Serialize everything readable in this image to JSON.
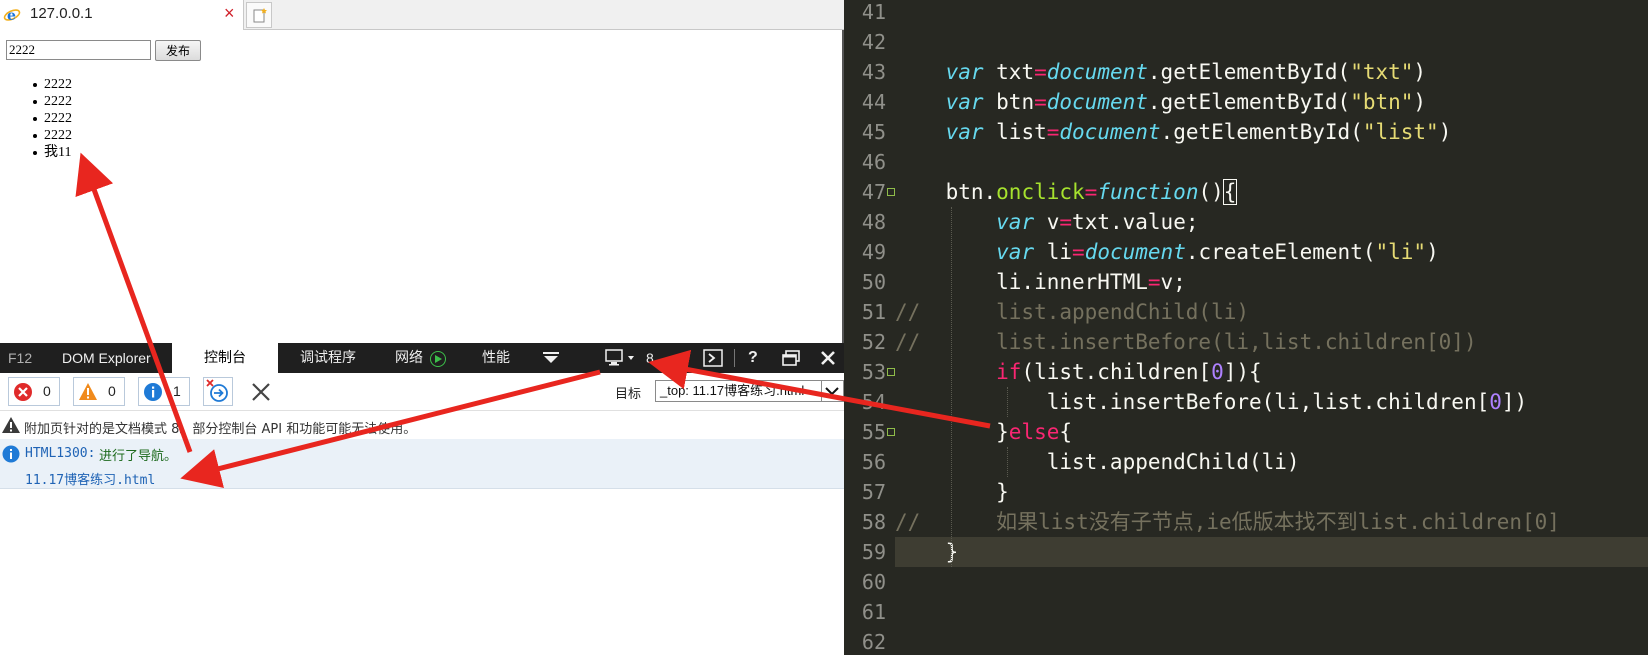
{
  "browser": {
    "tab_title": "127.0.0.1",
    "input_value": "2222",
    "publish_label": "发布",
    "list_items": [
      "2222",
      "2222",
      "2222",
      "2222",
      "我11"
    ]
  },
  "devtools": {
    "tabs": {
      "f12": "F12",
      "dom": "DOM Explorer",
      "console": "控制台",
      "debugger": "调试程序",
      "network": "网络",
      "performance": "性能"
    },
    "emulation_count": "8",
    "help": "?",
    "filters": {
      "errors": "0",
      "warnings": "0",
      "info": "1"
    },
    "target_label": "目标",
    "target_value": "_top: 11.17博客练习.html",
    "messages": {
      "warning": "附加页针对的是文档模式 8。部分控制台 API 和功能可能无法使用。",
      "info_code": "HTML1300:",
      "info_text": "进行了导航。",
      "info_link": "11.17博客练习.html"
    }
  },
  "editor": {
    "line_numbers": [
      "41",
      "42",
      "43",
      "44",
      "45",
      "46",
      "47",
      "48",
      "49",
      "50",
      "51",
      "52",
      "53",
      "54",
      "55",
      "56",
      "57",
      "58",
      "59",
      "60",
      "61",
      "62"
    ],
    "lines": [
      {
        "text": ""
      },
      {
        "text": ""
      },
      {
        "text": "    var txt=document.getElementById(\"txt\")"
      },
      {
        "text": "    var btn=document.getElementById(\"btn\")"
      },
      {
        "text": "    var list=document.getElementById(\"list\")"
      },
      {
        "text": ""
      },
      {
        "text": "    btn.onclick=function(){"
      },
      {
        "text": "        var v=txt.value;"
      },
      {
        "text": "        var li=document.createElement(\"li\")"
      },
      {
        "text": "        li.innerHTML=v;"
      },
      {
        "text": "//      list.appendChild(li)"
      },
      {
        "text": "//      list.insertBefore(li,list.children[0])"
      },
      {
        "text": "        if(list.children[0]){"
      },
      {
        "text": "            list.insertBefore(li,list.children[0])"
      },
      {
        "text": "        }else{"
      },
      {
        "text": "            list.appendChild(li)"
      },
      {
        "text": "        }"
      },
      {
        "text": "//      如果list没有子节点,ie低版本找不到list.children[0]"
      },
      {
        "text": "    }"
      },
      {
        "text": ""
      },
      {
        "text": ""
      },
      {
        "text": ""
      }
    ]
  },
  "colors": {
    "editor_bg": "#272822",
    "keyword": "#66d9ef",
    "operator": "#f92672",
    "string": "#e6db74",
    "function": "#a6e22e",
    "number": "#ae81ff",
    "comment": "#75715e",
    "arrow": "#e8261f"
  }
}
